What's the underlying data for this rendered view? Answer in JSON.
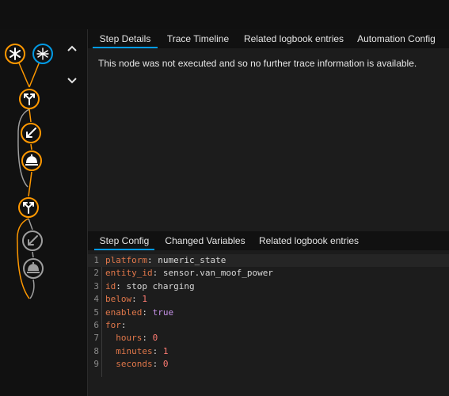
{
  "top_tabs": [
    {
      "label": "Step Details",
      "active": true
    },
    {
      "label": "Trace Timeline",
      "active": false
    },
    {
      "label": "Related logbook entries",
      "active": false
    },
    {
      "label": "Automation Config",
      "active": false
    }
  ],
  "step_message": "This node was not executed and so no further trace information is available.",
  "bottom_tabs": [
    {
      "label": "Step Config",
      "active": true
    },
    {
      "label": "Changed Variables",
      "active": false
    },
    {
      "label": "Related logbook entries",
      "active": false
    }
  ],
  "code_lines": [
    {
      "num": "1",
      "key": "platform",
      "sep": ": ",
      "value": "numeric_state",
      "type": "str"
    },
    {
      "num": "2",
      "key": "entity_id",
      "sep": ": ",
      "value": "sensor.van_moof_power",
      "type": "str"
    },
    {
      "num": "3",
      "key": "id",
      "sep": ": ",
      "value": "stop charging",
      "type": "str"
    },
    {
      "num": "4",
      "key": "below",
      "sep": ": ",
      "value": "1",
      "type": "num"
    },
    {
      "num": "5",
      "key": "enabled",
      "sep": ": ",
      "value": "true",
      "type": "bool"
    },
    {
      "num": "6",
      "key": "for",
      "sep": ":",
      "value": "",
      "type": "str"
    },
    {
      "num": "7",
      "key": "  hours",
      "sep": ": ",
      "value": "0",
      "type": "num"
    },
    {
      "num": "8",
      "key": "  minutes",
      "sep": ": ",
      "value": "1",
      "type": "num"
    },
    {
      "num": "9",
      "key": "  seconds",
      "sep": ": ",
      "value": "0",
      "type": "num"
    }
  ],
  "graph_nodes": [
    {
      "name": "trigger-node-1",
      "icon": "asterisk-icon",
      "state": "executed"
    },
    {
      "name": "trigger-node-2",
      "icon": "asterisk-icon",
      "state": "selected"
    },
    {
      "name": "choose-node-1",
      "icon": "branch-icon",
      "state": "executed"
    },
    {
      "name": "action-node-1",
      "icon": "arrow-down-left-icon",
      "state": "executed"
    },
    {
      "name": "action-node-2",
      "icon": "service-bell-icon",
      "state": "executed"
    },
    {
      "name": "choose-node-2",
      "icon": "branch-icon",
      "state": "executed"
    },
    {
      "name": "action-node-3",
      "icon": "arrow-down-left-icon",
      "state": "not-executed"
    },
    {
      "name": "action-node-4",
      "icon": "service-bell-icon",
      "state": "not-executed"
    }
  ],
  "colors": {
    "executed": "#ff9800",
    "selected": "#039be5",
    "not_executed": "#9e9e9e",
    "tab_indicator": "#039be5",
    "yaml_key": "#e0774a",
    "yaml_number": "#ff7b72",
    "yaml_bool": "#c792ea"
  }
}
